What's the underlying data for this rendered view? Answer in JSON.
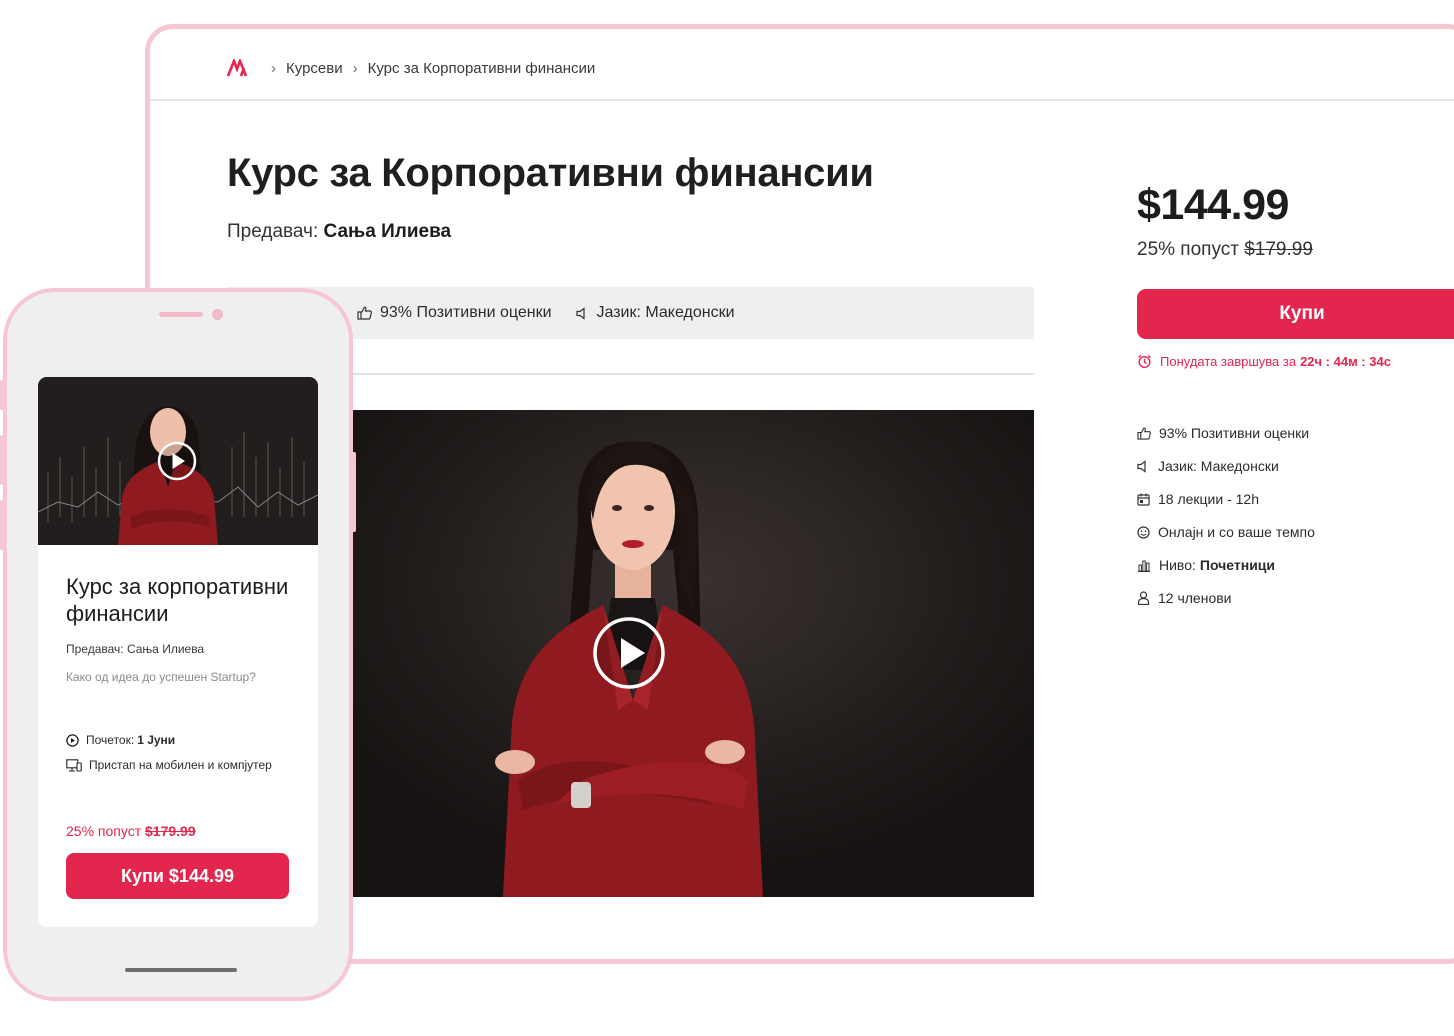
{
  "colors": {
    "accent": "#e3264e",
    "frame": "#f7c6d3",
    "info_bar": "#efefef"
  },
  "breadcrumb": {
    "logo": "logo-icon",
    "items": [
      "Курсеви",
      "Курс за Корпоративни финансии"
    ]
  },
  "course": {
    "title": "Курс за Корпоративни финансии",
    "instructor_label": "Предавач:",
    "instructor_name": "Сања Илиева"
  },
  "info_bar": {
    "rating": "93% Позитивни оценки",
    "language": "Јазик: Македонски"
  },
  "pricing": {
    "price": "$144.99",
    "discount_label": "25% попуст",
    "old_price": "$179.99",
    "buy_label": "Купи",
    "countdown_label": "Понудата завршува за",
    "countdown_value": "22ч : 44м : 34с"
  },
  "features": [
    {
      "icon": "thumbs-up-icon",
      "text": "93% Позитивни оценки"
    },
    {
      "icon": "speaker-icon",
      "text": "Јазик: Македонски"
    },
    {
      "icon": "calendar-icon",
      "text": "18 лекции - 12h"
    },
    {
      "icon": "smiley-icon",
      "text": "Онлајн и со ваше темпо"
    },
    {
      "icon": "bar-chart-icon",
      "label": "Ниво:",
      "value": "Почетници"
    },
    {
      "icon": "user-icon",
      "text": "12 членови"
    }
  ],
  "mobile": {
    "title": "Курс за корпоративни финансии",
    "instructor": "Предавач: Сања Илиева",
    "subtitle": "Како од идеа до успешен Startup?",
    "start_label": "Почеток:",
    "start_value": "1 Јуни",
    "access": "Пристап на мобилен и компјутер",
    "discount_label": "25% попуст",
    "old_price": "$179.99",
    "buy_label": "Купи $144.99"
  }
}
